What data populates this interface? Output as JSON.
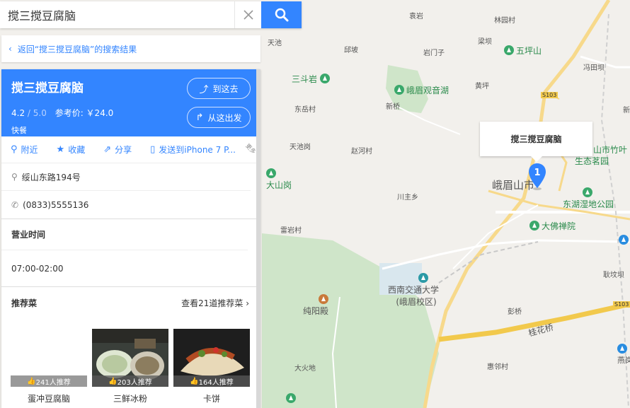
{
  "search": {
    "value": "搅三搅豆腐脑"
  },
  "back": {
    "label": "返回“搅三搅豆腐脑”的搜索结果"
  },
  "place": {
    "name": "搅三搅豆腐脑",
    "rating": "4.2",
    "rating_max": "/ 5.0",
    "price": "参考价: ￥24.0",
    "category": "快餐",
    "goto_label": "到这去",
    "from_label": "从这出发"
  },
  "actions": [
    {
      "label": "附近",
      "icon": "pin-icon"
    },
    {
      "label": "收藏",
      "icon": "star-icon"
    },
    {
      "label": "分享",
      "icon": "share-icon"
    },
    {
      "label": "发送到iPhone 7 P...",
      "icon": "phone-icon"
    }
  ],
  "more_tag": "更多",
  "address": "绥山东路194号",
  "phone": "(0833)5555136",
  "hours": {
    "title": "营业时间",
    "value": "07:00-02:00"
  },
  "dishes": {
    "title": "推荐菜",
    "more": "查看21道推荐菜 ›",
    "items": [
      {
        "name": "蛋冲豆腐脑",
        "badge": "241人推荐"
      },
      {
        "name": "三鲜冰粉",
        "badge": "203人推荐"
      },
      {
        "name": "卡饼",
        "badge": "164人推荐"
      }
    ]
  },
  "popup": {
    "label": "搅三搅豆腐脑"
  },
  "marker": {
    "number": "1"
  },
  "map_labels": {
    "tianchi": "天池",
    "yuanyan": "袁岩",
    "linyuancun": "林园村",
    "qiaopo": "邱坡",
    "yanmenzi": "岩门子",
    "liangxiang": "梁坝",
    "wupingshan": "五坪山",
    "fengtianpo": "冯田坝",
    "sandouyan": "三斗岩",
    "emeiguanyinhu": "峨眉观音湖",
    "huangping": "黄坪",
    "dongyuecun": "东岳村",
    "xinqiao": "新桥",
    "s103a": "S103",
    "tianchigang": "天池岗",
    "zhaohecun": "赵河村",
    "shanshizhuye": "山市竹叶",
    "shengtaimiaoyuan": "生态茗园",
    "dashangang": "大山岗",
    "emeishanshi": "峨眉山市",
    "chuanzhuxiang": "川主乡",
    "donghushidi": "东湖湿地公园",
    "leiyancun": "雷岩村",
    "dafochan": "大佛禅院",
    "xinanjiaoda": "西南交通大学",
    "emeixiaoqu": "(峨眉校区)",
    "chunyangdian": "纯阳殿",
    "shiyanpo": "耿坟坝",
    "pengqiao": "彭桥",
    "guihuaqiao": "桂花桥",
    "s103b": "S103",
    "dahuodi": "大火地",
    "huilincun": "惠邻村",
    "yan": "燕岗",
    "xin": "新",
    "yan2": "岩"
  }
}
